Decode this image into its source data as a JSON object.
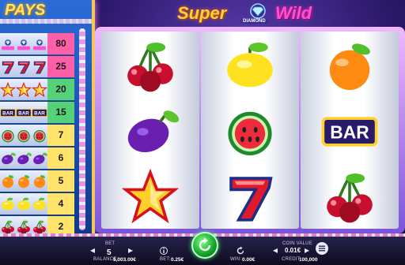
{
  "game": {
    "title_word1": "Super",
    "title_word2": "Wild",
    "title_badge": "DIAMOND"
  },
  "paytable": {
    "title": "PAYS",
    "rows": [
      {
        "symbol": "wild",
        "value": "80",
        "color": "#ff5fa8"
      },
      {
        "symbol": "seven",
        "value": "25",
        "color": "#ff5fa8"
      },
      {
        "symbol": "star",
        "value": "20",
        "color": "#55d17a"
      },
      {
        "symbol": "bar",
        "value": "15",
        "color": "#55d17a"
      },
      {
        "symbol": "watermelon",
        "value": "7",
        "color": "#ffe36b"
      },
      {
        "symbol": "plum",
        "value": "6",
        "color": "#ffe36b"
      },
      {
        "symbol": "orange",
        "value": "5",
        "color": "#ffe36b"
      },
      {
        "symbol": "lemon",
        "value": "4",
        "color": "#ffe36b"
      },
      {
        "symbol": "cherry",
        "value": "2",
        "color": "#ffe36b"
      }
    ]
  },
  "reels": [
    [
      "cherry",
      "plum",
      "star"
    ],
    [
      "lemon",
      "watermelon",
      "seven"
    ],
    [
      "orange",
      "bar",
      "cherry"
    ]
  ],
  "bar_label": "BAR",
  "footer": {
    "bet_label": "BET",
    "bet_value": "5",
    "balance_label": "BALANCE:",
    "balance_value": "5,003.00€",
    "bet_money_label": "BET:",
    "bet_money_value": "0.25€",
    "win_label": "WIN:",
    "win_value": "0.00€",
    "coin_label": "COIN VALUE",
    "coin_value": "0.01€",
    "credit_label": "CREDIT:",
    "credit_value": "100,000"
  }
}
